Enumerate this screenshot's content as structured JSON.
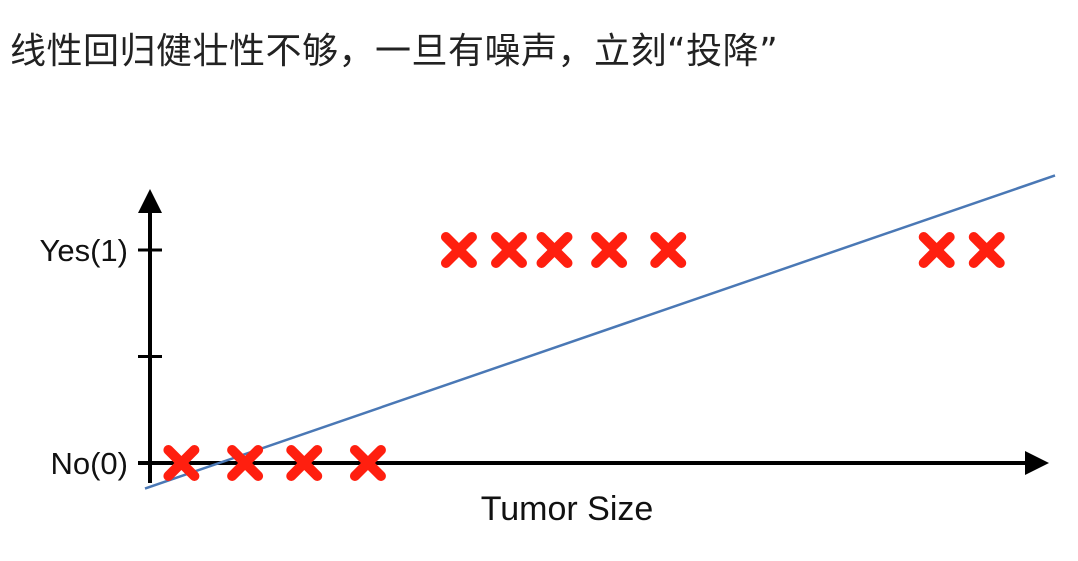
{
  "headline": "线性回归健壮性不够，一旦有噪声，立刻“投降”",
  "chart_data": {
    "type": "scatter",
    "xlabel": "Tumor Size",
    "ylabel": "",
    "y_tick_labels": [
      {
        "value": 1,
        "label": "Yes(1)"
      },
      {
        "value": 0,
        "label": "No(0)"
      }
    ],
    "y_minor_ticks": [
      0.5
    ],
    "ylim": [
      -0.12,
      1.25
    ],
    "xlim": [
      0,
      1
    ],
    "grid": false,
    "marker": "x",
    "marker_color": "#ff1f0f",
    "points": [
      {
        "x": 0.04,
        "y": 0
      },
      {
        "x": 0.11,
        "y": 0
      },
      {
        "x": 0.175,
        "y": 0
      },
      {
        "x": 0.245,
        "y": 0
      },
      {
        "x": 0.345,
        "y": 1
      },
      {
        "x": 0.4,
        "y": 1
      },
      {
        "x": 0.45,
        "y": 1
      },
      {
        "x": 0.51,
        "y": 1
      },
      {
        "x": 0.575,
        "y": 1
      },
      {
        "x": 0.87,
        "y": 1
      },
      {
        "x": 0.925,
        "y": 1
      }
    ],
    "fit_line": {
      "color": "#4a78b5",
      "x": [
        0,
        1
      ],
      "y": [
        -0.12,
        1.35
      ]
    }
  }
}
